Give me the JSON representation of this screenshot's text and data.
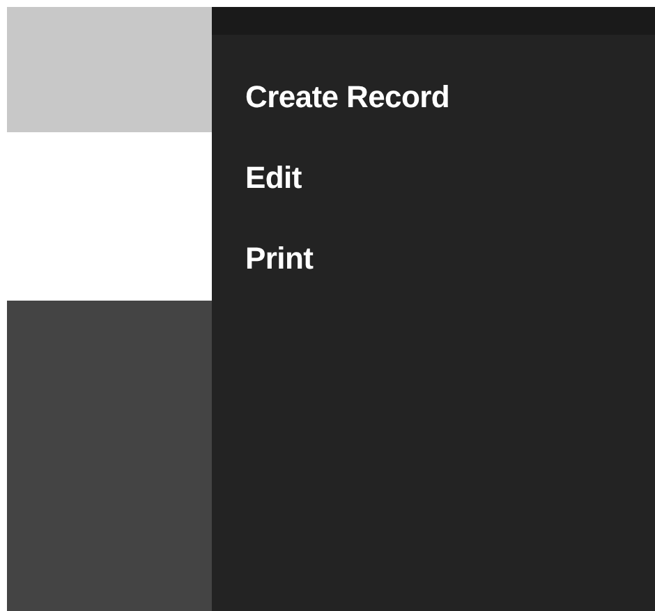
{
  "menu": {
    "items": [
      {
        "label": "Create Record"
      },
      {
        "label": "Edit"
      },
      {
        "label": "Print"
      }
    ]
  }
}
